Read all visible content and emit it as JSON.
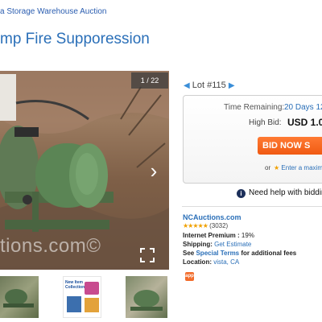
{
  "breadcrumb": "a Storage Warehouse Auction",
  "title": "mp Fire Supporession",
  "photo": {
    "counter": "1 / 22",
    "watermark": "tions.com©"
  },
  "thumbnails": [
    {
      "name": "photo-thumbnail"
    },
    {
      "name": "flyer-thumbnail",
      "text": "New Item Collection"
    },
    {
      "name": "photo-thumbnail"
    }
  ],
  "lot": {
    "label": "Lot #115"
  },
  "bid": {
    "time_label": "Time Remaining:",
    "time_value": "20 Days 12",
    "high_bid_label": "High Bid:",
    "high_bid_value": "USD 1.0",
    "bid_now": "BID NOW S",
    "or": "or",
    "max_link": "Enter a maximum"
  },
  "help": "Need help with biddin",
  "seller": {
    "name": "NCAuctions.com",
    "rating_count": "(3032)",
    "stars": "★★★★★",
    "internet_premium_label": "Internet Premium :",
    "internet_premium_value": "19%",
    "shipping_label": "Shipping:",
    "shipping_value": "Get Estimate",
    "see": "See",
    "special_terms": "Special Terms",
    "fees": "for additional fees",
    "location_label": "Location:",
    "location_value": "vista, CA"
  },
  "badge": "app"
}
